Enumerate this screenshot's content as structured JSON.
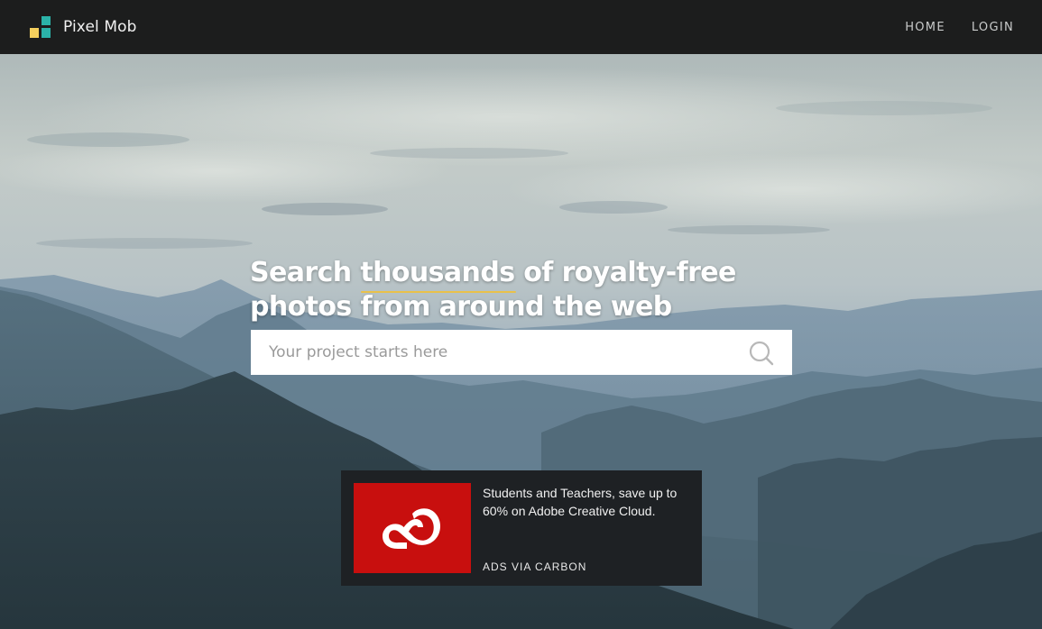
{
  "header": {
    "brand_name": "Pixel Mob",
    "nav": {
      "home_label": "HOME",
      "login_label": "LOGIN"
    }
  },
  "hero": {
    "headline_part1": "Search ",
    "headline_highlight": "thousands",
    "headline_part2": " of royalty-free photos from around the web",
    "search_placeholder": "Your project starts here",
    "search_icon": "search-icon"
  },
  "ad": {
    "text": "Students and Teachers, save up to 60% on Adobe Creative Cloud.",
    "powered_by": "ADS VIA CARBON",
    "image_icon": "adobe-creative-cloud-icon"
  },
  "colors": {
    "header_bg": "#1c1d1d",
    "highlight_underline": "#e9c14a",
    "logo_teal": "#2bb3a9",
    "logo_yellow": "#f4cf5d",
    "ad_bg": "#1e2124",
    "ad_image_bg": "#c80f0e"
  }
}
